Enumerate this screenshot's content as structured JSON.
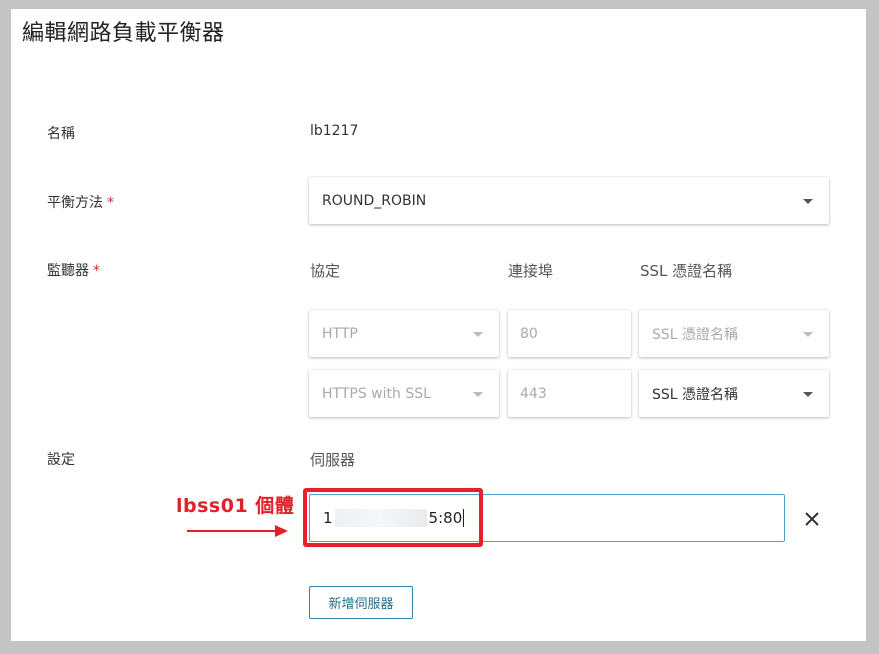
{
  "dialog": {
    "title": "編輯網路負載平衡器"
  },
  "form": {
    "name": {
      "label": "名稱",
      "value": "lb1217"
    },
    "method": {
      "label": "平衡方法",
      "required_mark": "*",
      "selected": "ROUND_ROBIN"
    },
    "listeners": {
      "label": "監聽器",
      "required_mark": "*",
      "columns": {
        "protocol": "協定",
        "port": "連接埠",
        "ssl": "SSL 憑證名稱"
      },
      "rows": [
        {
          "protocol": "HTTP",
          "port": "80",
          "ssl": "SSL 憑證名稱",
          "ssl_enabled": false
        },
        {
          "protocol": "HTTPS with SSL",
          "port": "443",
          "ssl": "SSL 憑證名稱",
          "ssl_enabled": true
        }
      ]
    },
    "settings": {
      "label": "設定",
      "servers_heading": "伺服器",
      "server_value_start": "1",
      "server_value_end": "5:80",
      "add_server_label": "新增伺服器"
    }
  },
  "annotation": {
    "text": "lbss01 個體",
    "color": "#e3202a"
  },
  "colors": {
    "accent": "#2b8aa6",
    "input_focus": "#4aa3c9",
    "required": "#d32f2f",
    "highlight": "#e8202a"
  },
  "icons": {
    "close": "close-icon",
    "dropdown": "chevron-down-icon"
  }
}
